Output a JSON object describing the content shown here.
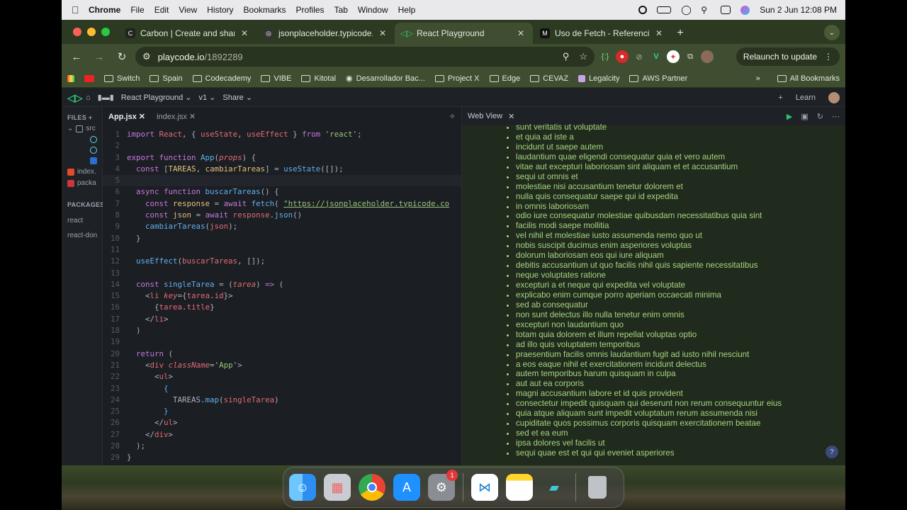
{
  "menubar": {
    "app": "Chrome",
    "items": [
      "File",
      "Edit",
      "View",
      "History",
      "Bookmarks",
      "Profiles",
      "Tab",
      "Window",
      "Help"
    ],
    "clock": "Sun 2 Jun  12:08 PM"
  },
  "tabs": [
    {
      "title": "Carbon | Create and share be",
      "icon": "carbon-icon"
    },
    {
      "title": "jsonplaceholder.typicode.com",
      "icon": "github-icon"
    },
    {
      "title": "React Playground",
      "icon": "playcode-icon",
      "active": true
    },
    {
      "title": "Uso de Fetch - Referencia de",
      "icon": "mdn-icon"
    }
  ],
  "address": {
    "host": "playcode.io",
    "path": "/1892289"
  },
  "relaunch": "Relaunch to update",
  "bookmarks": [
    "Switch",
    "Spain",
    "Codecademy",
    "VIBE",
    "Kitotal",
    "Desarrollador Bac...",
    "Project X",
    "Edge",
    "CEVAZ",
    "Legalcity",
    "AWS Partner"
  ],
  "all_bookmarks": "All Bookmarks",
  "playcode": {
    "project": "React Playground",
    "version": "v1",
    "share": "Share",
    "learn": "Learn",
    "files_header": "FILES",
    "folder": "src",
    "file1": "index.",
    "file2": "packa",
    "packages_header": "PACKAGES",
    "pkg1": "react",
    "pkg2": "react-don",
    "editor_tab_active": "App.jsx",
    "editor_tab_2": "index.jsx",
    "webview_title": "Web View"
  },
  "web_items": [
    "sunt veritatis ut voluptate",
    "et quia ad iste a",
    "incidunt ut saepe autem",
    "laudantium quae eligendi consequatur quia et vero autem",
    "vitae aut excepturi laboriosam sint aliquam et et accusantium",
    "sequi ut omnis et",
    "molestiae nisi accusantium tenetur dolorem et",
    "nulla quis consequatur saepe qui id expedita",
    "in omnis laboriosam",
    "odio iure consequatur molestiae quibusdam necessitatibus quia sint",
    "facilis modi saepe mollitia",
    "vel nihil et molestiae iusto assumenda nemo quo ut",
    "nobis suscipit ducimus enim asperiores voluptas",
    "dolorum laboriosam eos qui iure aliquam",
    "debitis accusantium ut quo facilis nihil quis sapiente necessitatibus",
    "neque voluptates ratione",
    "excepturi a et neque qui expedita vel voluptate",
    "explicabo enim cumque porro aperiam occaecati minima",
    "sed ab consequatur",
    "non sunt delectus illo nulla tenetur enim omnis",
    "excepturi non laudantium quo",
    "totam quia dolorem et illum repellat voluptas optio",
    "ad illo quis voluptatem temporibus",
    "praesentium facilis omnis laudantium fugit ad iusto nihil nesciunt",
    "a eos eaque nihil et exercitationem incidunt delectus",
    "autem temporibus harum quisquam in culpa",
    "aut aut ea corporis",
    "magni accusantium labore et id quis provident",
    "consectetur impedit quisquam qui deserunt non rerum consequuntur eius",
    "quia atque aliquam sunt impedit voluptatum rerum assumenda nisi",
    "cupiditate quos possimus corporis quisquam exercitationem beatae",
    "sed et ea eum",
    "ipsa dolores vel facilis ut",
    "sequi quae est et qui qui eveniet asperiores"
  ],
  "dock": {
    "badge": "1"
  },
  "colors": {
    "chrome_accent": "#3f4d30",
    "list_green": "#a6d47e",
    "editor_bg": "#1b1e23"
  }
}
